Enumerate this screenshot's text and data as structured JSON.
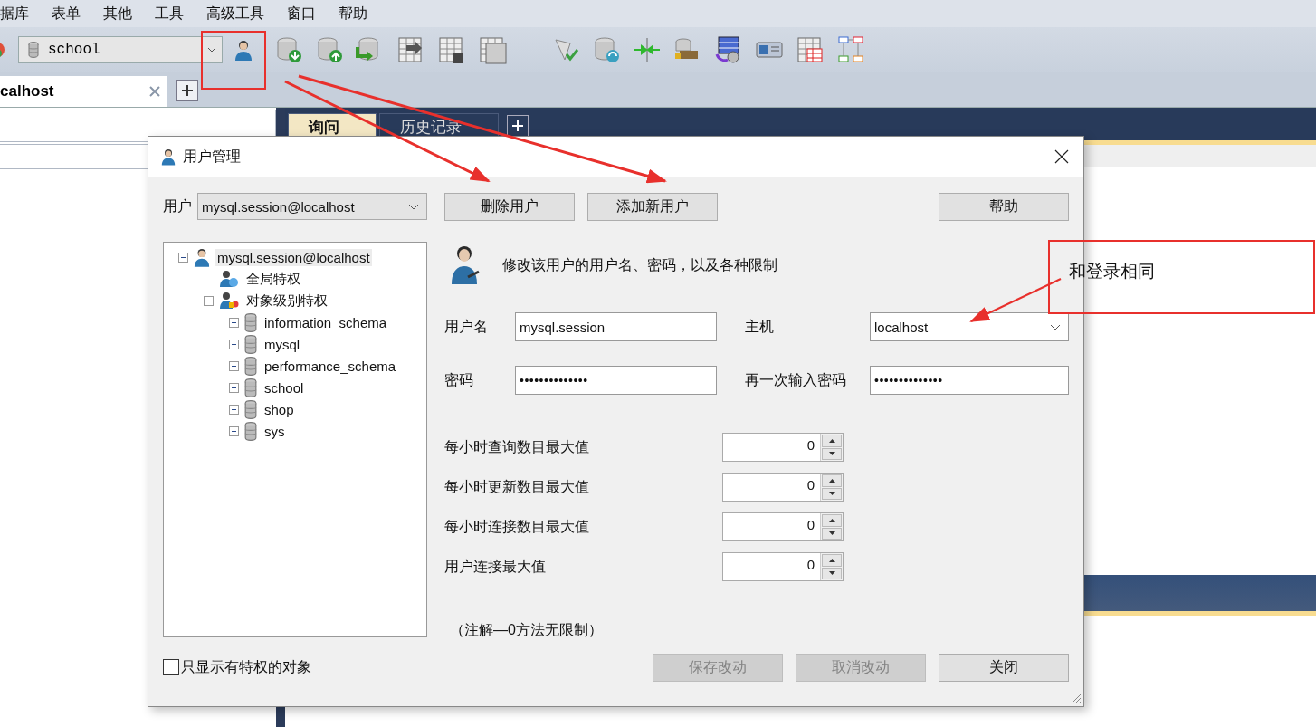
{
  "menu": [
    {
      "label": "据库"
    },
    {
      "label": "表单"
    },
    {
      "label": "其他"
    },
    {
      "label": "工具"
    },
    {
      "label": "高级工具"
    },
    {
      "label": "窗口"
    },
    {
      "label": "帮助"
    }
  ],
  "toolbar": {
    "database_select": {
      "value": "school"
    }
  },
  "connection_tabs": [
    {
      "label": "calhost",
      "selected": true
    }
  ],
  "query_tabs": [
    {
      "label": "询问",
      "selected": true
    },
    {
      "label": "历史记录",
      "selected": false
    }
  ],
  "dialog": {
    "title": "用户管理",
    "user_label": "用户",
    "user_select": "mysql.session@localhost",
    "tree": [
      {
        "label": "mysql.session@localhost",
        "kind": "user",
        "selected": true,
        "expanded": true,
        "children": [
          {
            "label": "全局特权",
            "kind": "global",
            "selected": false
          },
          {
            "label": "对象级别特权",
            "kind": "object",
            "selected": false,
            "expanded": true,
            "children": [
              {
                "label": "information_schema",
                "kind": "database",
                "selected": false,
                "expanded": false
              },
              {
                "label": "mysql",
                "kind": "database",
                "selected": false,
                "expanded": false
              },
              {
                "label": "performance_schema",
                "kind": "database",
                "selected": false,
                "expanded": false
              },
              {
                "label": "school",
                "kind": "database",
                "selected": false,
                "expanded": false
              },
              {
                "label": "shop",
                "kind": "database",
                "selected": false,
                "expanded": false
              },
              {
                "label": "sys",
                "kind": "database",
                "selected": false,
                "expanded": false
              }
            ]
          }
        ]
      }
    ],
    "top_buttons": [
      {
        "label": "删除用户"
      },
      {
        "label": "添加新用户"
      }
    ],
    "help_button": "帮助",
    "description": "修改该用户的用户名、密码，以及各种限制",
    "username": {
      "label": "用户名",
      "value": "mysql.session"
    },
    "host": {
      "label": "主机",
      "value": "localhost"
    },
    "password": {
      "label": "密码",
      "value": "••••••••••••••"
    },
    "password_again": {
      "label": "再一次输入密码",
      "value": "••••••••••••••"
    },
    "limits": [
      {
        "label": "每小时查询数目最大值",
        "value": "0"
      },
      {
        "label": "每小时更新数目最大值",
        "value": "0"
      },
      {
        "label": "每小时连接数目最大值",
        "value": "0"
      },
      {
        "label": "用户连接最大值",
        "value": "0"
      }
    ],
    "note": "（注解—0方法无限制）",
    "show_privileged": {
      "label": "只显示有特权的对象",
      "checked": false
    },
    "footer_buttons": [
      {
        "label": "保存改动",
        "disabled": true
      },
      {
        "label": "取消改动",
        "disabled": true
      },
      {
        "label": "关闭",
        "disabled": false
      }
    ]
  },
  "annotation": {
    "text": "和登录相同"
  }
}
